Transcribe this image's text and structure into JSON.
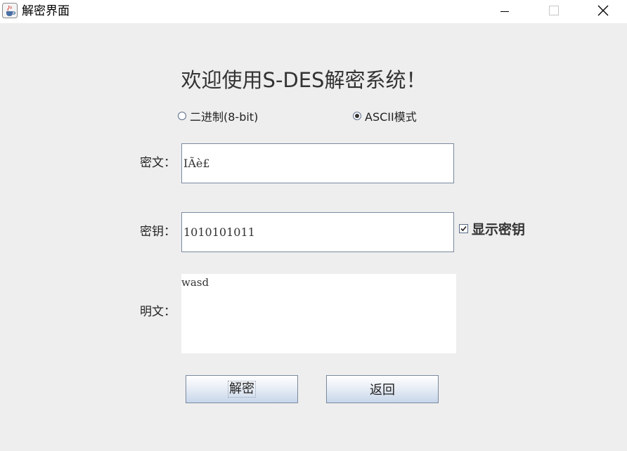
{
  "window": {
    "title": "解密界面",
    "app_icon": "java-cup-icon",
    "controls": {
      "minimize_icon": "minimize-icon",
      "maximize_icon": "maximize-icon",
      "close_icon": "close-icon"
    }
  },
  "main": {
    "heading": "欢迎使用S-DES解密系统！",
    "mode": {
      "options": [
        {
          "label": "二进制(8-bit)",
          "selected": false
        },
        {
          "label": "ASCII模式",
          "selected": true
        }
      ]
    },
    "fields": {
      "ciphertext": {
        "label": "密文：",
        "value": "IÃè£"
      },
      "key": {
        "label": "密钥：",
        "value": "1010101011"
      },
      "plaintext": {
        "label": "明文：",
        "value": "wasd"
      }
    },
    "show_key": {
      "label": "显示密钥",
      "checked": true
    },
    "buttons": {
      "decrypt": "解密",
      "back": "返回"
    }
  }
}
